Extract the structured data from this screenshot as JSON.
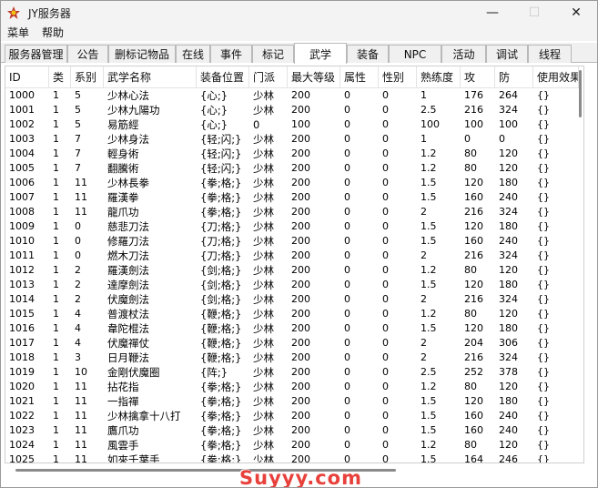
{
  "window": {
    "title": "JY服务器",
    "icon": "app-logo-icon",
    "controls": {
      "minimize": "—",
      "maximize": "☐",
      "close": "✕"
    }
  },
  "menubar": {
    "items": [
      "菜单",
      "帮助"
    ]
  },
  "tabs": {
    "items": [
      "服务器管理",
      "公告",
      "删标记物品",
      "在线",
      "事件",
      "标记",
      "武学",
      "装备",
      "NPC",
      "活动",
      "调试",
      "线程"
    ],
    "active": "武学"
  },
  "table": {
    "columns": [
      "ID",
      "类",
      "系别",
      "武学名称",
      "装备位置",
      "门派",
      "最大等级",
      "属性",
      "性别",
      "熟练度",
      "攻",
      "防",
      "使用效果"
    ],
    "rows": [
      [
        "1000",
        "1",
        "5",
        "少林心法",
        "{心;}",
        "少林",
        "200",
        "0",
        "0",
        "1",
        "176",
        "264",
        "{}"
      ],
      [
        "1001",
        "1",
        "5",
        "少林九陽功",
        "{心;}",
        "少林",
        "200",
        "0",
        "0",
        "2.5",
        "216",
        "324",
        "{}"
      ],
      [
        "1002",
        "1",
        "5",
        "易筋經",
        "{心;}",
        "0",
        "100",
        "0",
        "0",
        "100",
        "100",
        "100",
        "{}"
      ],
      [
        "1003",
        "1",
        "7",
        "少林身法",
        "{轻;闪;}",
        "少林",
        "200",
        "0",
        "0",
        "1",
        "0",
        "0",
        "{}"
      ],
      [
        "1004",
        "1",
        "7",
        "輕身術",
        "{轻;闪;}",
        "少林",
        "200",
        "0",
        "0",
        "1.2",
        "80",
        "120",
        "{}"
      ],
      [
        "1005",
        "1",
        "7",
        "翻騰術",
        "{轻;闪;}",
        "少林",
        "200",
        "0",
        "0",
        "1.2",
        "80",
        "120",
        "{}"
      ],
      [
        "1006",
        "1",
        "11",
        "少林長拳",
        "{拳;格;}",
        "少林",
        "200",
        "0",
        "0",
        "1.5",
        "120",
        "180",
        "{}"
      ],
      [
        "1007",
        "1",
        "11",
        "羅漢拳",
        "{拳;格;}",
        "少林",
        "200",
        "0",
        "0",
        "1.5",
        "160",
        "240",
        "{}"
      ],
      [
        "1008",
        "1",
        "11",
        "龍爪功",
        "{拳;格;}",
        "少林",
        "200",
        "0",
        "0",
        "2",
        "216",
        "324",
        "{}"
      ],
      [
        "1009",
        "1",
        "0",
        "慈悲刀法",
        "{刀;格;}",
        "少林",
        "200",
        "0",
        "0",
        "1.5",
        "120",
        "180",
        "{}"
      ],
      [
        "1010",
        "1",
        "0",
        "修羅刀法",
        "{刀;格;}",
        "少林",
        "200",
        "0",
        "0",
        "1.5",
        "160",
        "240",
        "{}"
      ],
      [
        "1011",
        "1",
        "0",
        "燃木刀法",
        "{刀;格;}",
        "少林",
        "200",
        "0",
        "0",
        "2",
        "216",
        "324",
        "{}"
      ],
      [
        "1012",
        "1",
        "2",
        "羅漢劍法",
        "{剑;格;}",
        "少林",
        "200",
        "0",
        "0",
        "1.2",
        "80",
        "120",
        "{}"
      ],
      [
        "1013",
        "1",
        "2",
        "達摩劍法",
        "{剑;格;}",
        "少林",
        "200",
        "0",
        "0",
        "1.5",
        "120",
        "180",
        "{}"
      ],
      [
        "1014",
        "1",
        "2",
        "伏魔劍法",
        "{剑;格;}",
        "少林",
        "200",
        "0",
        "0",
        "2",
        "216",
        "324",
        "{}"
      ],
      [
        "1015",
        "1",
        "4",
        "普渡杖法",
        "{鞭;格;}",
        "少林",
        "200",
        "0",
        "0",
        "1.2",
        "80",
        "120",
        "{}"
      ],
      [
        "1016",
        "1",
        "4",
        "韋陀棍法",
        "{鞭;格;}",
        "少林",
        "200",
        "0",
        "0",
        "1.5",
        "120",
        "180",
        "{}"
      ],
      [
        "1017",
        "1",
        "4",
        "伏魔禪仗",
        "{鞭;格;}",
        "少林",
        "200",
        "0",
        "0",
        "2",
        "204",
        "306",
        "{}"
      ],
      [
        "1018",
        "1",
        "3",
        "日月鞭法",
        "{鞭;格;}",
        "少林",
        "200",
        "0",
        "0",
        "2",
        "216",
        "324",
        "{}"
      ],
      [
        "1019",
        "1",
        "10",
        "金剛伏魔圈",
        "{阵;}",
        "少林",
        "200",
        "0",
        "0",
        "2.5",
        "252",
        "378",
        "{}"
      ],
      [
        "1020",
        "1",
        "11",
        "拈花指",
        "{拳;格;}",
        "少林",
        "200",
        "0",
        "0",
        "1.2",
        "80",
        "120",
        "{}"
      ],
      [
        "1021",
        "1",
        "11",
        "一指禪",
        "{拳;格;}",
        "少林",
        "200",
        "0",
        "0",
        "1.5",
        "120",
        "180",
        "{}"
      ],
      [
        "1022",
        "1",
        "11",
        "少林擒拿十八打",
        "{拳;格;}",
        "少林",
        "200",
        "0",
        "0",
        "1.5",
        "160",
        "240",
        "{}"
      ],
      [
        "1023",
        "1",
        "11",
        "鷹爪功",
        "{拳;格;}",
        "少林",
        "200",
        "0",
        "0",
        "1.5",
        "160",
        "240",
        "{}"
      ],
      [
        "1024",
        "1",
        "11",
        "風雲手",
        "{拳;格;}",
        "少林",
        "200",
        "0",
        "0",
        "1.2",
        "80",
        "120",
        "{}"
      ],
      [
        "1025",
        "1",
        "11",
        "如來千葉手",
        "{拳;格;}",
        "少林",
        "200",
        "0",
        "0",
        "1.5",
        "164",
        "246",
        "{}"
      ]
    ]
  },
  "watermark": "Suyyy.com"
}
